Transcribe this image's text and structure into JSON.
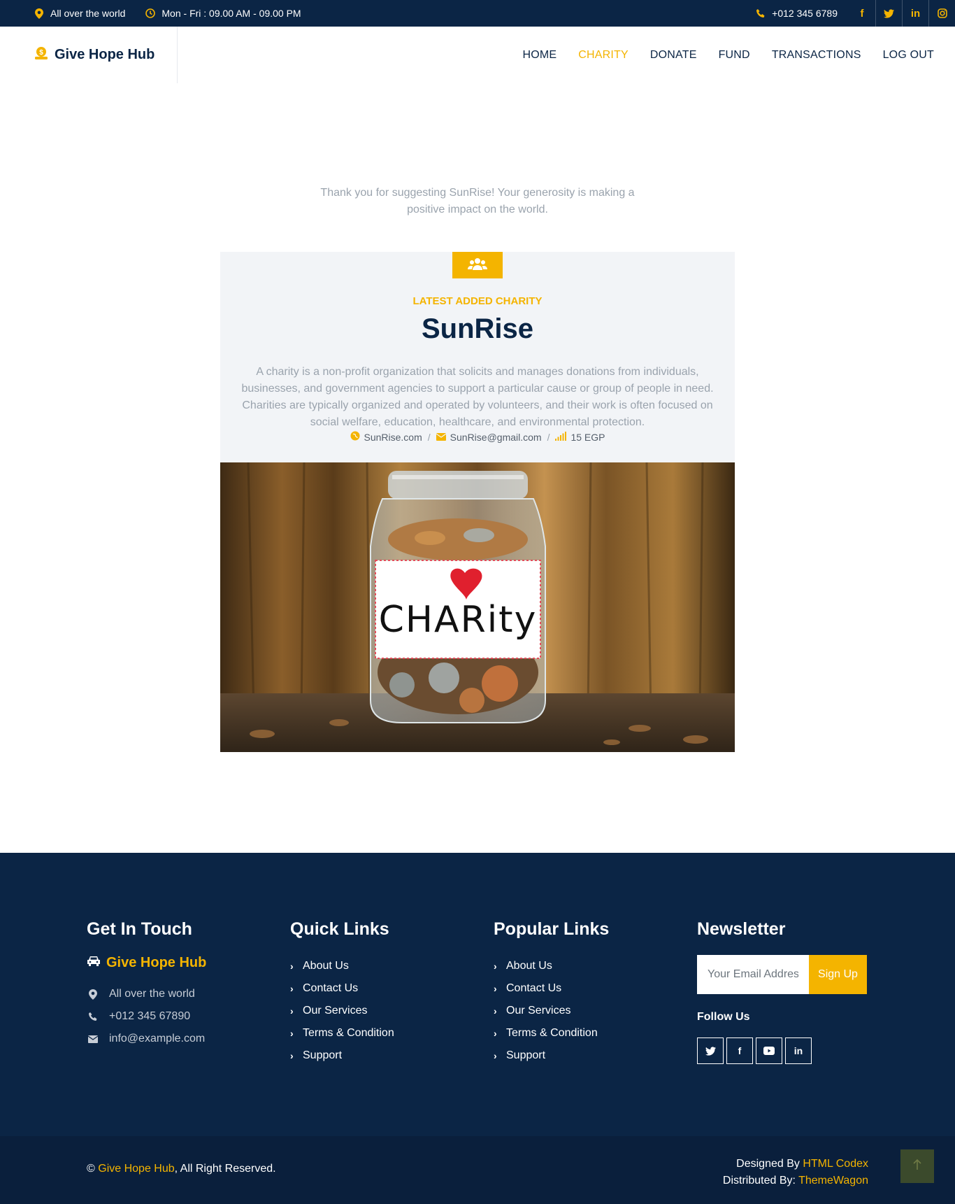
{
  "topbar": {
    "location": "All over the world",
    "hours": "Mon - Fri : 09.00 AM - 09.00 PM",
    "phone": "+012 345 6789",
    "socials": [
      "facebook-icon",
      "twitter-icon",
      "linkedin-icon",
      "instagram-icon"
    ]
  },
  "navbar": {
    "brand": "Give Hope Hub",
    "links": [
      "HOME",
      "CHARITY",
      "DONATE",
      "FUND",
      "TRANSACTIONS",
      "LOG OUT"
    ],
    "active": "CHARITY"
  },
  "thanks": "Thank you for suggesting SunRise! Your generosity is making a positive impact on the world.",
  "card": {
    "kicker": "LATEST ADDED CHARITY",
    "title": "SunRise",
    "description": "A charity is a non-profit organization that solicits and manages donations from individuals, businesses, and government agencies to support a particular cause or group of people in need. Charities are typically organized and operated by volunteers, and their work is often focused on social welfare, education, healthcare, and environmental protection.",
    "website": "SunRise.com",
    "email": "SunRise@gmail.com",
    "amount": "15 EGP",
    "image_label": "CHARity"
  },
  "footer": {
    "get_in_touch": {
      "title": "Get In Touch",
      "brand": "Give Hope Hub",
      "address": "All over the world",
      "phone": "+012 345 67890",
      "email": "info@example.com"
    },
    "quick_links": {
      "title": "Quick Links",
      "items": [
        "About Us",
        "Contact Us",
        "Our Services",
        "Terms & Condition",
        "Support"
      ]
    },
    "popular_links": {
      "title": "Popular Links",
      "items": [
        "About Us",
        "Contact Us",
        "Our Services",
        "Terms & Condition",
        "Support"
      ]
    },
    "newsletter": {
      "title": "Newsletter",
      "placeholder": "Your Email Address",
      "button": "Sign Up",
      "follow": "Follow Us",
      "socials": [
        "twitter-icon",
        "facebook-icon",
        "youtube-icon",
        "linkedin-icon"
      ]
    }
  },
  "copyright": {
    "symbol": "©",
    "brand": "Give Hope Hub",
    "rights": ", All Right Reserved.",
    "designed_prefix": "Designed By",
    "designed_by": "HTML Codex",
    "distributed_prefix": "Distributed By:",
    "distributed_by": "ThemeWagon"
  },
  "colors": {
    "navy": "#0b2545",
    "accent": "#f4b400",
    "muted": "#9aa3ad"
  }
}
